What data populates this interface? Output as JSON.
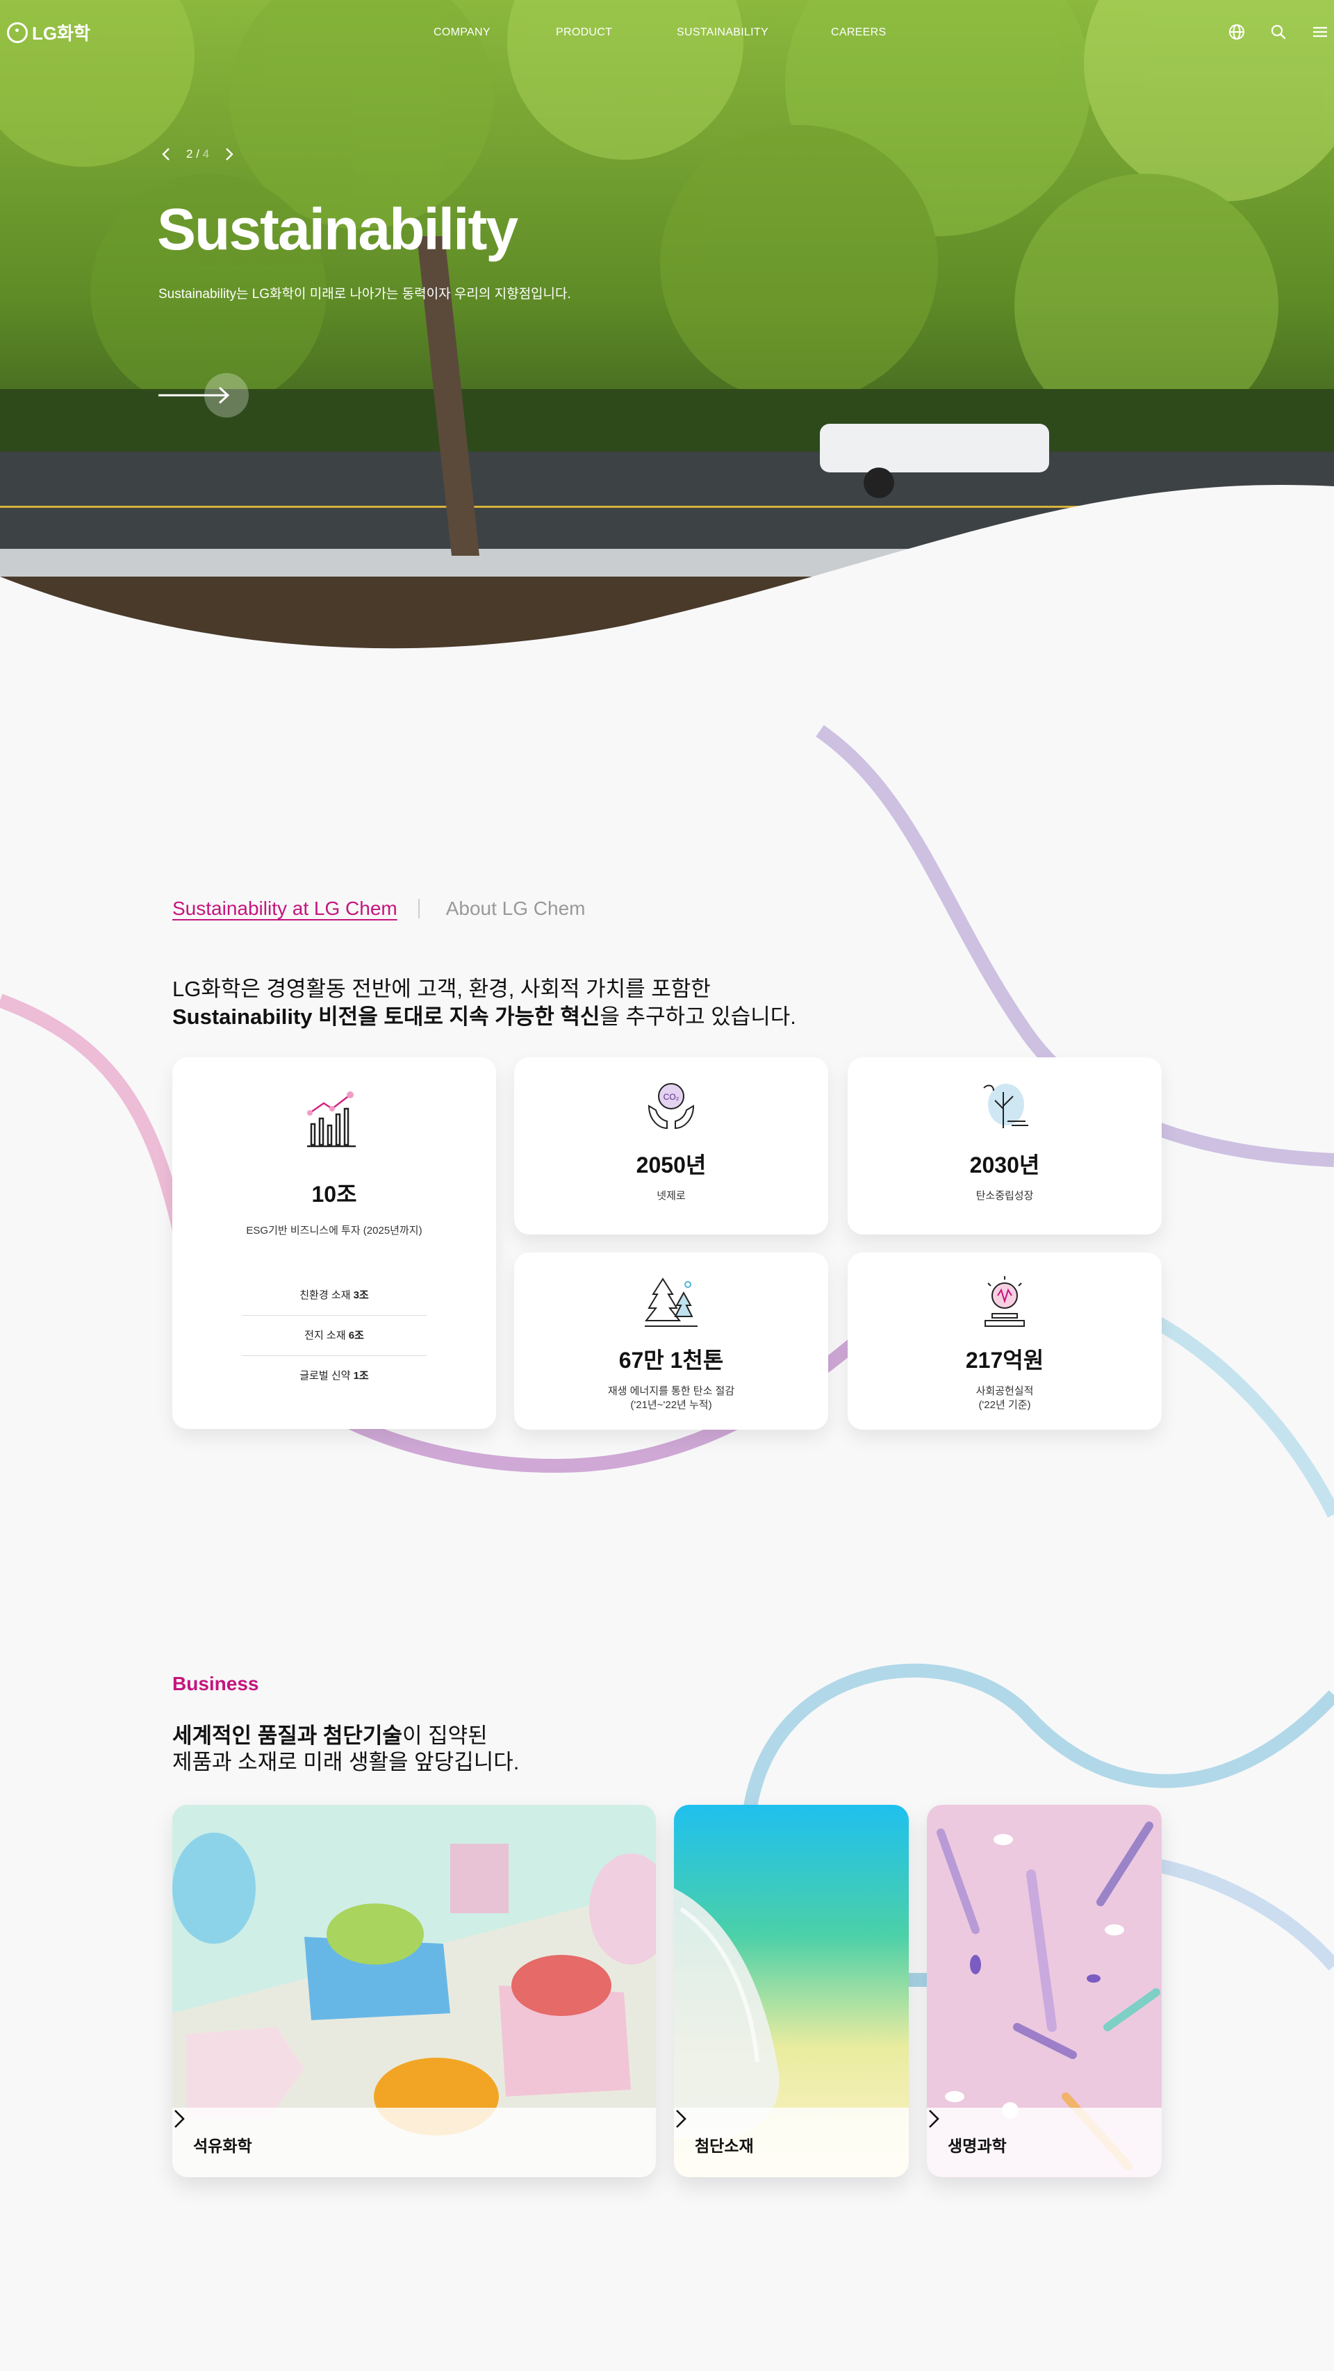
{
  "header": {
    "logo_text": "LG화학",
    "nav": [
      "COMPANY",
      "PRODUCT",
      "SUSTAINABILITY",
      "CAREERS"
    ],
    "icons": [
      "globe-icon",
      "search-icon",
      "menu-icon"
    ]
  },
  "hero": {
    "slide_current": "2",
    "slide_separator": "/",
    "slide_total": "4",
    "title": "Sustainability",
    "subtitle": "Sustainability는 LG화학이 미래로 나아가는 동력이자 우리의 지향점입니다."
  },
  "sustainability": {
    "tab_active": "Sustainability at LG Chem",
    "tab_inactive": "About LG Chem",
    "lead_line1": "LG화학은 경영활동 전반에 고객, 환경, 사회적 가치를 포함한",
    "lead_line2_bold": "Sustainability 비전을 토대로 지속 가능한 혁신",
    "lead_line2_rest": "을 추구하고 있습니다.",
    "main_card": {
      "value": "10조",
      "label": "ESG기반 비즈니스에 투자 (2025년까지)",
      "items": [
        {
          "label": "친환경 소재",
          "amount": "3조"
        },
        {
          "label": "전지 소재",
          "amount": "6조"
        },
        {
          "label": "글로벌 신약",
          "amount": "1조"
        }
      ]
    },
    "cards": [
      {
        "value": "2050년",
        "label": "넷제로",
        "icon": "co2-hands-icon"
      },
      {
        "value": "2030년",
        "label": "탄소중립성장",
        "icon": "leaf-growth-icon"
      },
      {
        "value": "67만 1천톤",
        "label": "재생 에너지를 통한 탄소 절감",
        "label2": "('21년~'22년 누적)",
        "icon": "trees-icon"
      },
      {
        "value": "217억원",
        "label": "사회공헌실적",
        "label2": "('22년 기준)",
        "icon": "donation-globe-icon"
      }
    ]
  },
  "business": {
    "title": "Business",
    "lead_bold": "세계적인 품질과 첨단기술",
    "lead_rest": "이 집약된",
    "lead_line2": "제품과 소재로 미래 생활을 앞당깁니다.",
    "cards": [
      {
        "name": "석유화학"
      },
      {
        "name": "첨단소재"
      },
      {
        "name": "생명과학"
      }
    ]
  },
  "colors": {
    "accent": "#c4157c",
    "hero_green": "#6f9a2c",
    "background": "#f8f8f9"
  }
}
